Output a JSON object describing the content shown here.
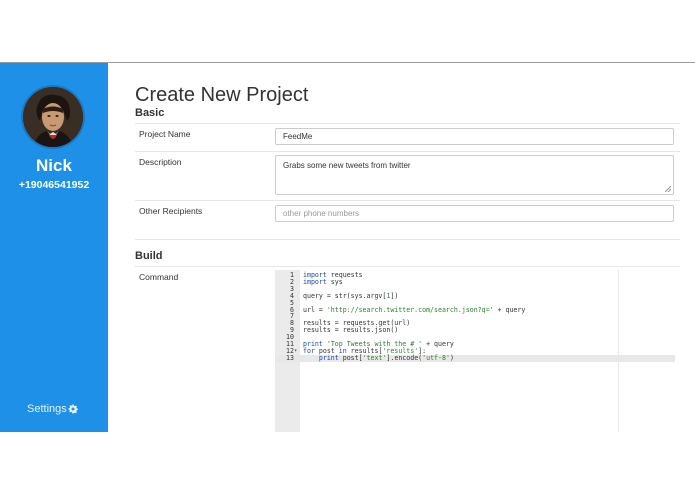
{
  "sidebar": {
    "user_name": "Nick",
    "user_phone": "+19046541952",
    "settings_label": "Settings",
    "settings_icon": "gear-icon",
    "avatar": "profile-photo"
  },
  "page": {
    "title": "Create New Project"
  },
  "basic": {
    "section_title": "Basic",
    "project_name_label": "Project Name",
    "project_name_value": "FeedMe",
    "description_label": "Description",
    "description_value": "Grabs some new tweets from twitter",
    "recipients_label": "Other Recipients",
    "recipients_placeholder": "other phone numbers"
  },
  "build": {
    "section_title": "Build",
    "command_label": "Command",
    "code_lines": [
      {
        "n": "1",
        "fold": "",
        "html": "<span class='kw'>import</span> requests"
      },
      {
        "n": "2",
        "fold": "",
        "html": "<span class='kw'>import</span> sys"
      },
      {
        "n": "3",
        "fold": "",
        "html": ""
      },
      {
        "n": "4",
        "fold": "",
        "html": "query = str(sys.argv[<span class='num'>1</span>])"
      },
      {
        "n": "5",
        "fold": "",
        "html": ""
      },
      {
        "n": "6",
        "fold": "",
        "html": "url = <span class='str'>'http://search.twitter.com/search.json?q='</span> + query"
      },
      {
        "n": "7",
        "fold": "",
        "html": ""
      },
      {
        "n": "8",
        "fold": "",
        "html": "results = requests.get(url)"
      },
      {
        "n": "9",
        "fold": "",
        "html": "results = results.json()"
      },
      {
        "n": "10",
        "fold": "",
        "html": ""
      },
      {
        "n": "11",
        "fold": "",
        "html": "<span class='kw'>print</span> <span class='str'>'Top Tweets with the # '</span> + query"
      },
      {
        "n": "12",
        "fold": "▾",
        "html": "<span class='kw'>for</span> post <span class='kw'>in</span> results[<span class='str'>'results'</span>]:"
      },
      {
        "n": "13",
        "fold": "",
        "html": "    <span class='kw'>print</span> post[<span class='str'>'text'</span>].encode(<span class='str'>'utf-8'</span>)"
      }
    ],
    "active_line": 13
  }
}
